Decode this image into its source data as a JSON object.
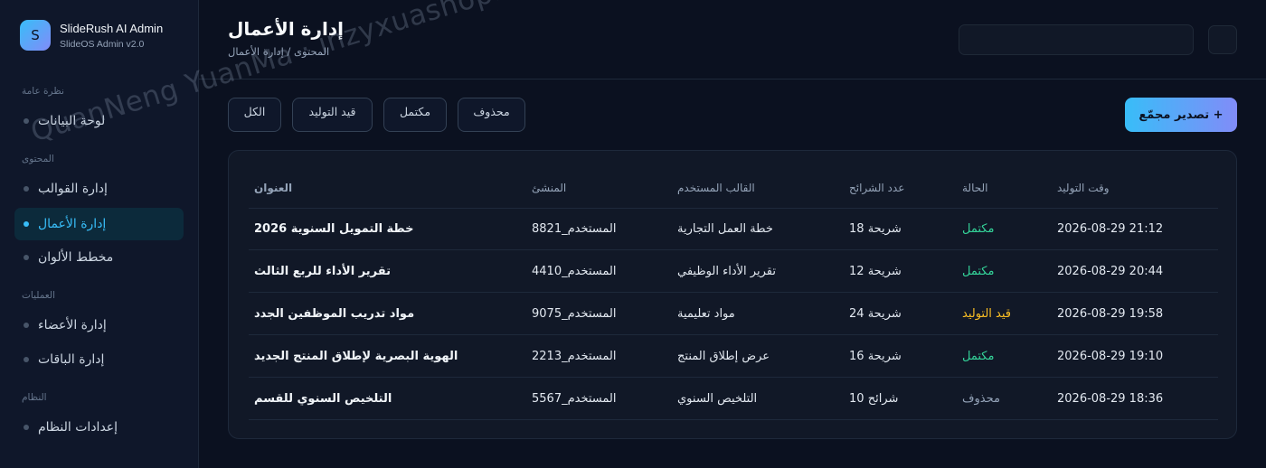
{
  "brand": {
    "logo_letter": "S",
    "name": "SlideRush AI Admin",
    "subtitle": "SlideOS Admin v2.0"
  },
  "sidebar": {
    "sections": [
      {
        "label": "نظرة عامة"
      },
      {
        "label": "المحتوى"
      },
      {
        "label": "العمليات"
      },
      {
        "label": "النظام"
      }
    ],
    "items": [
      {
        "label": "لوحة البيانات",
        "active": false
      },
      {
        "label": "إدارة القوالب",
        "active": false
      },
      {
        "label": "إدارة الأعمال",
        "active": true
      },
      {
        "label": "مخطط الألوان",
        "active": false
      },
      {
        "label": "إدارة الأعضاء",
        "active": false
      },
      {
        "label": "إدارة الباقات",
        "active": false
      },
      {
        "label": "إعدادات النظام",
        "active": false
      }
    ]
  },
  "header": {
    "title": "إدارة الأعمال",
    "breadcrumb": "المحتوى / إدارة الأعمال",
    "search_value": ""
  },
  "filters": [
    {
      "label": "الكل"
    },
    {
      "label": "قيد التوليد"
    },
    {
      "label": "مكتمل"
    },
    {
      "label": "محذوف"
    }
  ],
  "export_button": "تصدير مجمّع +",
  "table": {
    "headers": {
      "title": "العنوان",
      "creator": "المنشئ",
      "template": "القالب المستخدم",
      "slides": "عدد الشرائح",
      "status": "الحالة",
      "time": "وقت التوليد"
    },
    "rows": [
      {
        "title": "خطة التمويل السنوية 2026",
        "creator": "المستخدم_8821",
        "template": "خطة العمل التجارية",
        "slides": "18 شريحة",
        "status": "مكتمل",
        "status_key": "done",
        "time": "2026-08-29 21:12"
      },
      {
        "title": "تقرير الأداء للربع الثالث",
        "creator": "المستخدم_4410",
        "template": "تقرير الأداء الوظيفي",
        "slides": "12 شريحة",
        "status": "مكتمل",
        "status_key": "done",
        "time": "2026-08-29 20:44"
      },
      {
        "title": "مواد تدريب الموظفين الجدد",
        "creator": "المستخدم_9075",
        "template": "مواد تعليمية",
        "slides": "24 شريحة",
        "status": "قيد التوليد",
        "status_key": "gen",
        "time": "2026-08-29 19:58"
      },
      {
        "title": "الهوية البصرية لإطلاق المنتج الجديد",
        "creator": "المستخدم_2213",
        "template": "عرض إطلاق المنتج",
        "slides": "16 شريحة",
        "status": "مكتمل",
        "status_key": "done",
        "time": "2026-08-29 19:10"
      },
      {
        "title": "التلخيص السنوي للقسم",
        "creator": "المستخدم_5567",
        "template": "التلخيص السنوي",
        "slides": "10 شرائح",
        "status": "محذوف",
        "status_key": "del",
        "time": "2026-08-29 18:36"
      }
    ]
  },
  "watermark": "QuanNeng YuanMa · inzyxuashop.com",
  "colors": {
    "accent": "#38bdf8",
    "accent2": "#818cf8",
    "done": "#34d399",
    "generating": "#fbbf24",
    "deleted": "#94a3b8"
  }
}
